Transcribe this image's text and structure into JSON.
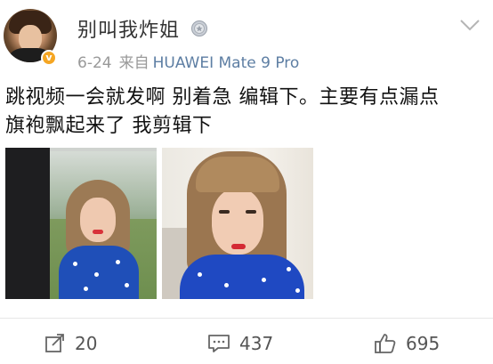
{
  "post": {
    "author": {
      "name": "别叫我炸姐"
    },
    "meta": {
      "date": "6-24",
      "source_label": "来自",
      "device": "HUAWEI Mate 9 Pro"
    },
    "text_lines": [
      "跳视频一会就发啊 别着急 编辑下。主要有点漏点",
      "旗袍飘起来了 我剪辑下"
    ],
    "actions": {
      "repost_count": "20",
      "comment_count": "437",
      "like_count": "695"
    }
  },
  "icons": {
    "verified": "verified-badge-icon",
    "medal": "medal-icon",
    "menu": "chevron-down-icon",
    "repost": "repost-icon",
    "comment": "comment-icon",
    "like": "thumbs-up-icon"
  },
  "colors": {
    "link": "#5d7ea3",
    "muted": "#999999",
    "badge": "#f5a623"
  }
}
